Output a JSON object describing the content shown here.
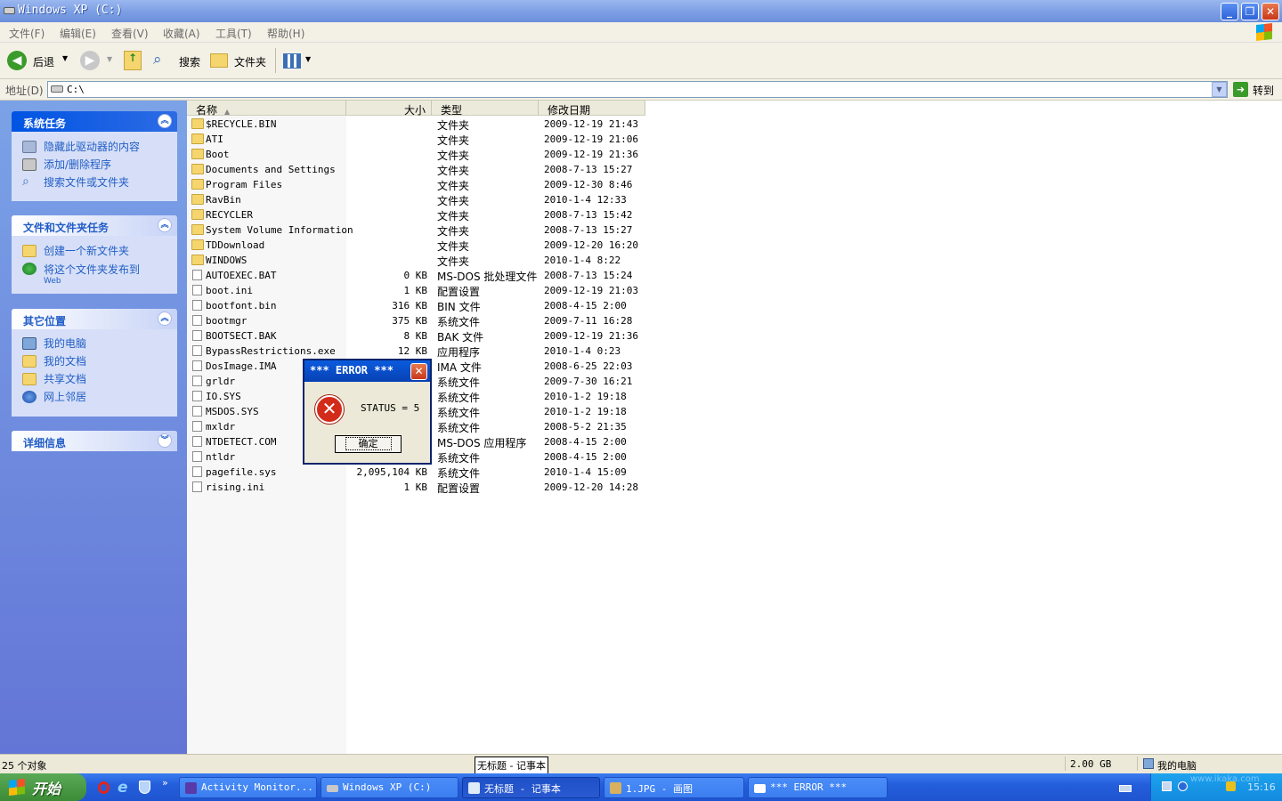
{
  "window": {
    "title": "Windows XP (C:)",
    "minimize_glyph": "_",
    "maximize_glyph": "❐",
    "close_glyph": "✕"
  },
  "menu": [
    "文件(F)",
    "编辑(E)",
    "查看(V)",
    "收藏(A)",
    "工具(T)",
    "帮助(H)"
  ],
  "toolbar": {
    "back": "后退",
    "search": "搜索",
    "folders": "文件夹"
  },
  "address": {
    "label": "地址(D)",
    "value": "C:\\",
    "go": "转到"
  },
  "side": {
    "system_tasks": {
      "title": "系统任务",
      "items": [
        "隐藏此驱动器的内容",
        "添加/删除程序",
        "搜索文件或文件夹"
      ]
    },
    "file_tasks": {
      "title": "文件和文件夹任务",
      "items": [
        "创建一个新文件夹",
        "将这个文件夹发布到",
        "Web"
      ]
    },
    "other_places": {
      "title": "其它位置",
      "items": [
        "我的电脑",
        "我的文档",
        "共享文档",
        "网上邻居"
      ]
    },
    "details": {
      "title": "详细信息"
    }
  },
  "columns": {
    "name": "名称",
    "size": "大小",
    "type": "类型",
    "modified": "修改日期"
  },
  "files": [
    {
      "name": "$RECYCLE.BIN",
      "size": "",
      "type": "文件夹",
      "modified": "2009-12-19 21:43",
      "kind": "folder"
    },
    {
      "name": "ATI",
      "size": "",
      "type": "文件夹",
      "modified": "2009-12-19 21:06",
      "kind": "folder"
    },
    {
      "name": "Boot",
      "size": "",
      "type": "文件夹",
      "modified": "2009-12-19 21:36",
      "kind": "folder"
    },
    {
      "name": "Documents and Settings",
      "size": "",
      "type": "文件夹",
      "modified": "2008-7-13 15:27",
      "kind": "folder"
    },
    {
      "name": "Program Files",
      "size": "",
      "type": "文件夹",
      "modified": "2009-12-30 8:46",
      "kind": "folder"
    },
    {
      "name": "RavBin",
      "size": "",
      "type": "文件夹",
      "modified": "2010-1-4 12:33",
      "kind": "folder"
    },
    {
      "name": "RECYCLER",
      "size": "",
      "type": "文件夹",
      "modified": "2008-7-13 15:42",
      "kind": "folder"
    },
    {
      "name": "System Volume Information",
      "size": "",
      "type": "文件夹",
      "modified": "2008-7-13 15:27",
      "kind": "folder"
    },
    {
      "name": "TDDownload",
      "size": "",
      "type": "文件夹",
      "modified": "2009-12-20 16:20",
      "kind": "folder"
    },
    {
      "name": "WINDOWS",
      "size": "",
      "type": "文件夹",
      "modified": "2010-1-4 8:22",
      "kind": "folder"
    },
    {
      "name": "AUTOEXEC.BAT",
      "size": "0 KB",
      "type": "MS-DOS 批处理文件",
      "modified": "2008-7-13 15:24",
      "kind": "file"
    },
    {
      "name": "boot.ini",
      "size": "1 KB",
      "type": "配置设置",
      "modified": "2009-12-19 21:03",
      "kind": "file"
    },
    {
      "name": "bootfont.bin",
      "size": "316 KB",
      "type": "BIN 文件",
      "modified": "2008-4-15 2:00",
      "kind": "file"
    },
    {
      "name": "bootmgr",
      "size": "375 KB",
      "type": "系统文件",
      "modified": "2009-7-11 16:28",
      "kind": "file"
    },
    {
      "name": "BOOTSECT.BAK",
      "size": "8 KB",
      "type": "BAK 文件",
      "modified": "2009-12-19 21:36",
      "kind": "file"
    },
    {
      "name": "BypassRestrictions.exe",
      "size": "12 KB",
      "type": "应用程序",
      "modified": "2010-1-4 0:23",
      "kind": "file"
    },
    {
      "name": "DosImage.IMA",
      "size": "",
      "type": "IMA 文件",
      "modified": "2008-6-25 22:03",
      "kind": "file"
    },
    {
      "name": "grldr",
      "size": "",
      "type": "系统文件",
      "modified": "2009-7-30 16:21",
      "kind": "file"
    },
    {
      "name": "IO.SYS",
      "size": "",
      "type": "系统文件",
      "modified": "2010-1-2 19:18",
      "kind": "file"
    },
    {
      "name": "MSDOS.SYS",
      "size": "",
      "type": "系统文件",
      "modified": "2010-1-2 19:18",
      "kind": "file"
    },
    {
      "name": "mxldr",
      "size": "",
      "type": "系统文件",
      "modified": "2008-5-2 21:35",
      "kind": "file"
    },
    {
      "name": "NTDETECT.COM",
      "size": "",
      "type": "MS-DOS 应用程序",
      "modified": "2008-4-15 2:00",
      "kind": "file"
    },
    {
      "name": "ntldr",
      "size": "",
      "type": "系统文件",
      "modified": "2008-4-15 2:00",
      "kind": "file"
    },
    {
      "name": "pagefile.sys",
      "size": "2,095,104 KB",
      "type": "系统文件",
      "modified": "2010-1-4 15:09",
      "kind": "file"
    },
    {
      "name": "rising.ini",
      "size": "1 KB",
      "type": "配置设置",
      "modified": "2009-12-20 14:28",
      "kind": "file"
    }
  ],
  "dialog": {
    "title": "*** ERROR ***",
    "message": "STATUS = 5",
    "ok": "确定",
    "close_glyph": "✕",
    "error_glyph": "✕"
  },
  "status": {
    "count": "25 个对象",
    "tooltip": "无标题 - 记事本",
    "size": "2.00 GB",
    "location": "我的电脑"
  },
  "taskbar": {
    "start": "开始",
    "tasks": [
      "Activity Monitor...",
      "Windows XP (C:)",
      "无标题 - 记事本",
      "1.JPG - 画图",
      "*** ERROR ***"
    ],
    "clock": "15:16",
    "watermark": "www.ikaka.com"
  },
  "colors": {
    "title_blue": "#7ea0e4",
    "panel_blue": "#6375d6",
    "taskbar_blue": "#245edb",
    "start_green": "#3c8b36",
    "error_red": "#d32b1a"
  }
}
